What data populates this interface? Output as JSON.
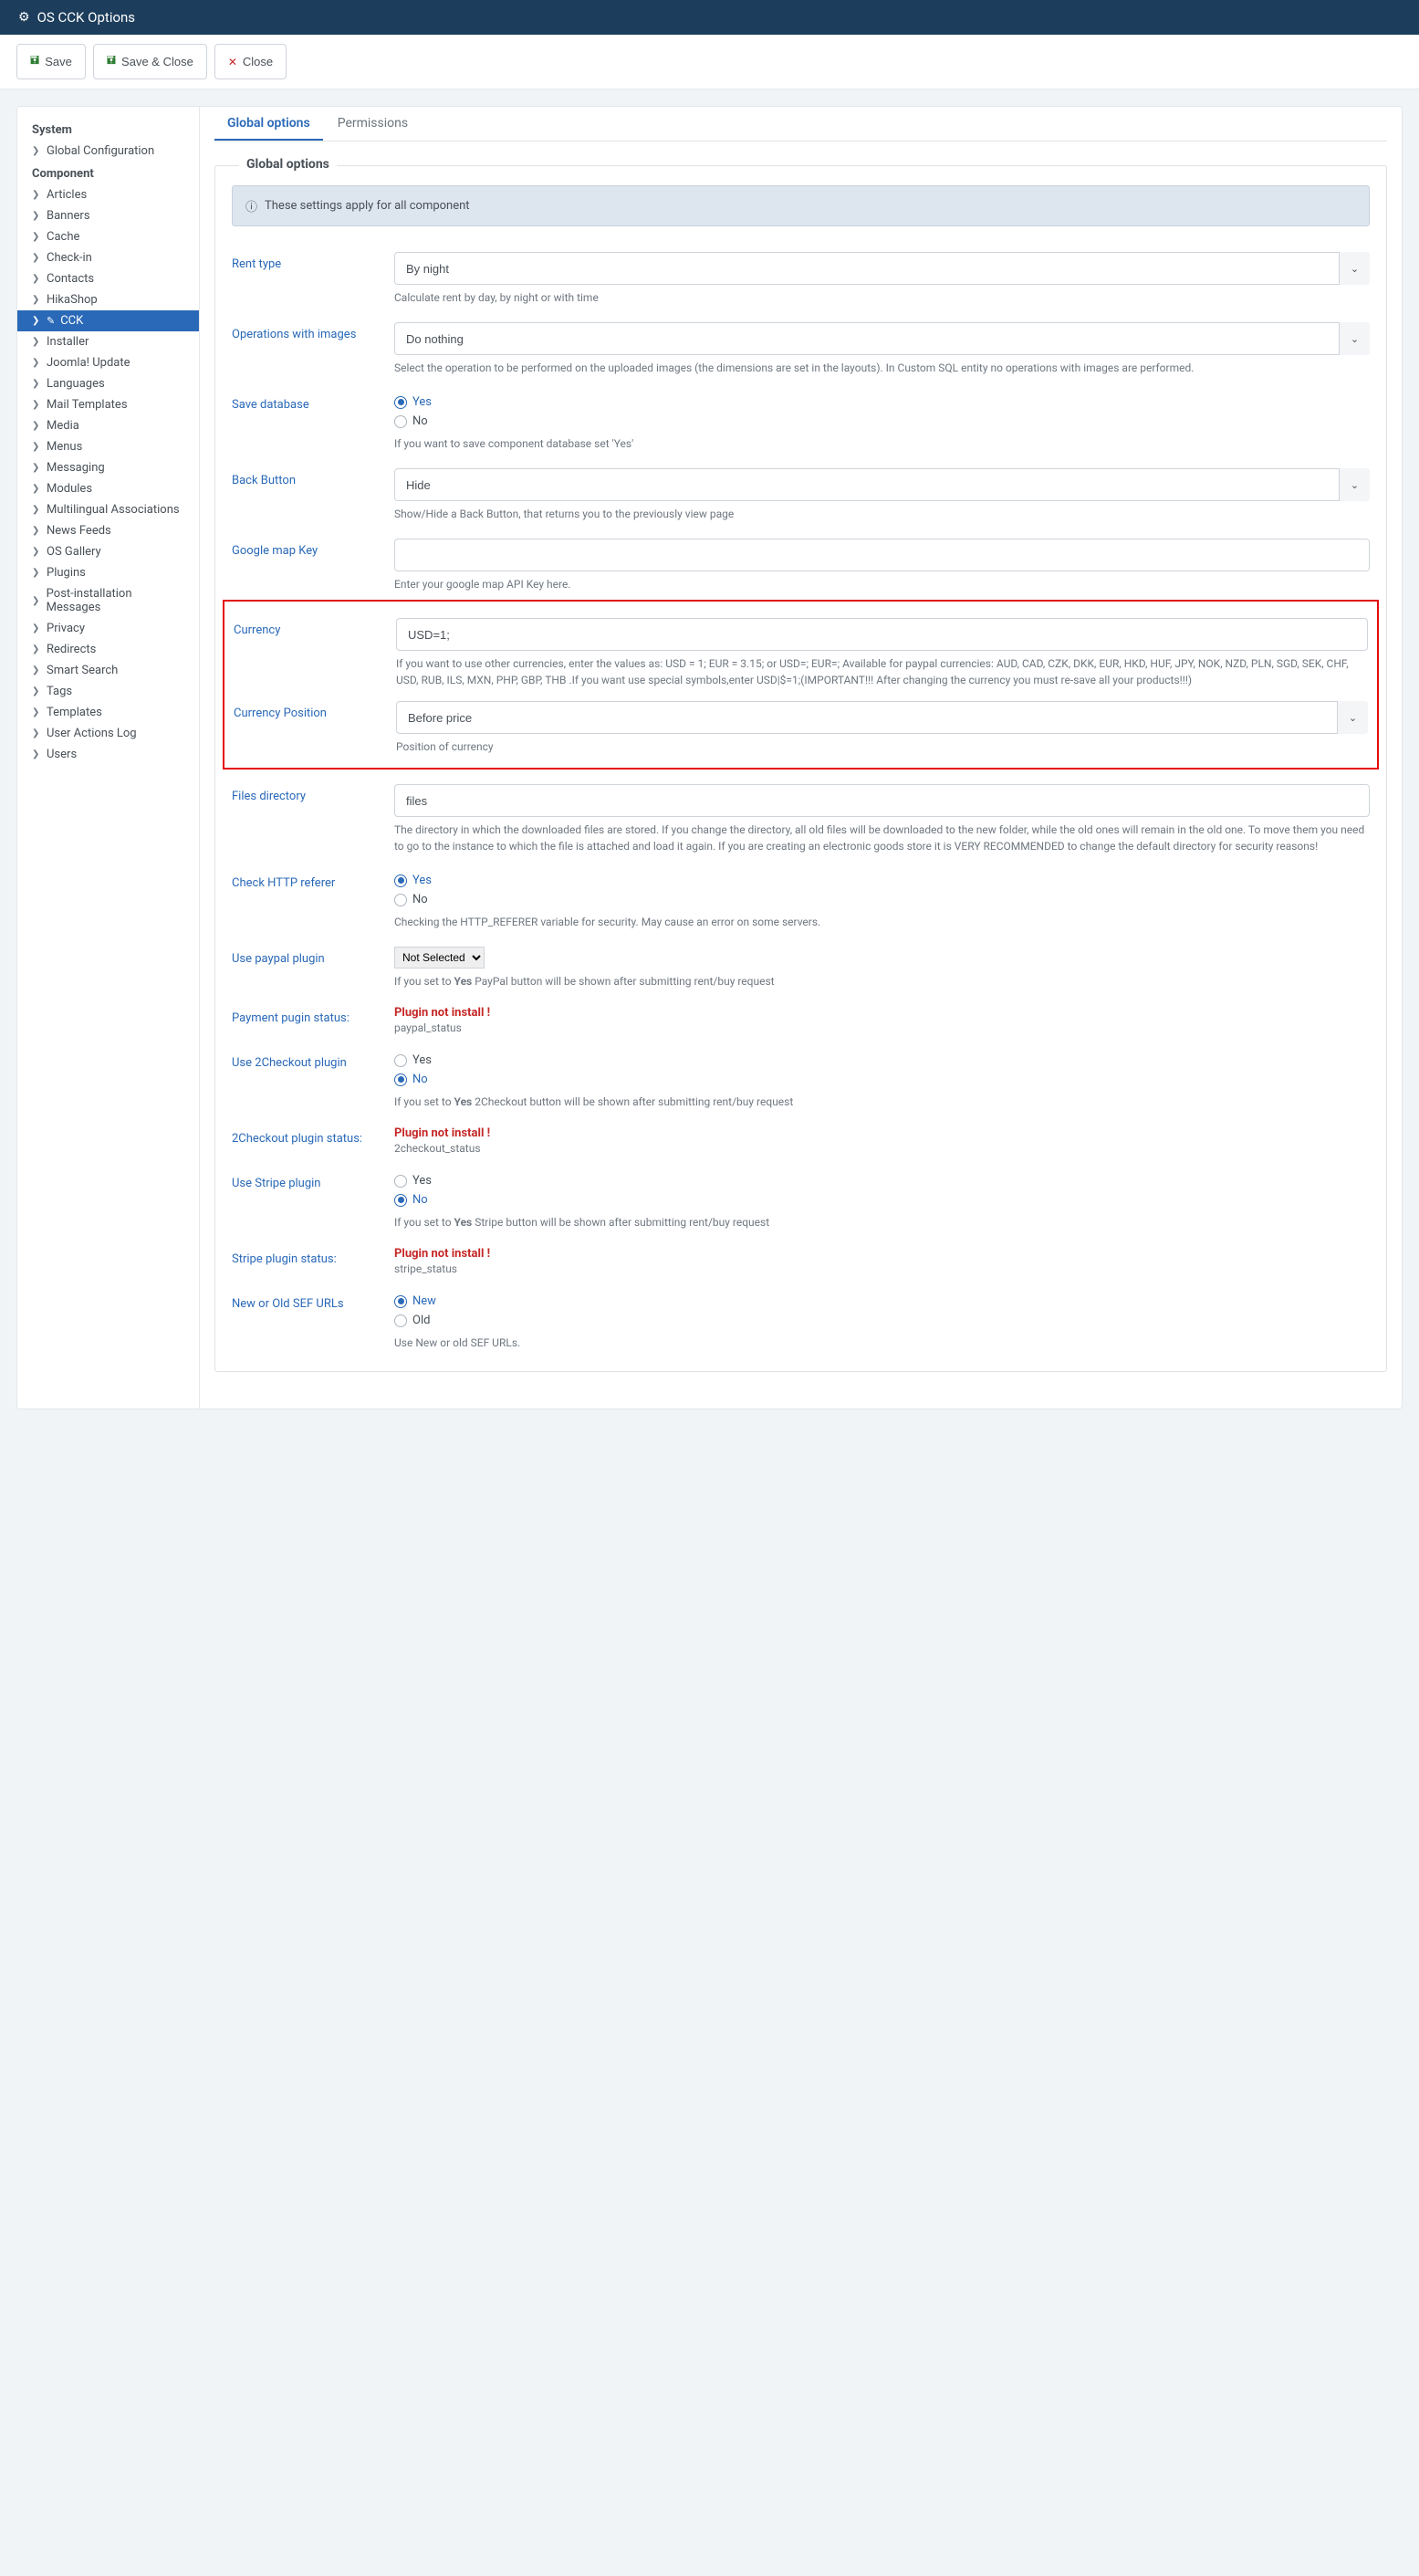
{
  "header": {
    "title": "OS CCK Options"
  },
  "toolbar": {
    "save": "Save",
    "save_close": "Save & Close",
    "close": "Close"
  },
  "sidebar": {
    "system_heading": "System",
    "system_items": [
      "Global Configuration"
    ],
    "component_heading": "Component",
    "component_items": [
      "Articles",
      "Banners",
      "Cache",
      "Check-in",
      "Contacts",
      "HikaShop",
      "CCK",
      "Installer",
      "Joomla! Update",
      "Languages",
      "Mail Templates",
      "Media",
      "Menus",
      "Messaging",
      "Modules",
      "Multilingual Associations",
      "News Feeds",
      "OS Gallery",
      "Plugins",
      "Post-installation Messages",
      "Privacy",
      "Redirects",
      "Smart Search",
      "Tags",
      "Templates",
      "User Actions Log",
      "Users"
    ],
    "active_component": "CCK"
  },
  "tabs": {
    "global": "Global options",
    "permissions": "Permissions"
  },
  "legend": "Global options",
  "info": "These settings apply for all component",
  "fields": {
    "rent_type": {
      "label": "Rent type",
      "value": "By night",
      "help": "Calculate rent by day, by night or with time"
    },
    "op_images": {
      "label": "Operations with images",
      "value": "Do nothing",
      "help": "Select the operation to be performed on the uploaded images (the dimensions are set in the layouts). In Custom SQL entity no operations with images are performed."
    },
    "save_db": {
      "label": "Save database",
      "yes": "Yes",
      "no": "No",
      "help": "If you want to save component database set 'Yes'",
      "selected": "yes"
    },
    "back_btn": {
      "label": "Back Button",
      "value": "Hide",
      "help": "Show/Hide a Back Button, that returns you to the previously view page"
    },
    "gmap": {
      "label": "Google map Key",
      "value": "",
      "help": "Enter your google map API Key here."
    },
    "currency": {
      "label": "Currency",
      "value": "USD=1;",
      "help": "If you want to use other currencies, enter the values as: USD = 1; EUR = 3.15; or USD=; EUR=; Available for paypal currencies: AUD, CAD, CZK, DKK, EUR, HKD, HUF, JPY, NOK, NZD, PLN, SGD, SEK, CHF, USD, RUB, ILS, MXN, PHP, GBP, THB .If you want use special symbols,enter USD|$=1;(IMPORTANT!!! After changing the currency you must re-save all your products!!!)"
    },
    "currency_pos": {
      "label": "Currency Position",
      "value": "Before price",
      "help": "Position of currency"
    },
    "files_dir": {
      "label": "Files directory",
      "value": "files",
      "help": "The directory in which the downloaded files are stored. If you change the directory, all old files will be downloaded to the new folder, while the old ones will remain in the old one. To move them you need to go to the instance to which the file is attached and load it again. If you are creating an electronic goods store it is VERY RECOMMENDED to change the default directory for security reasons!"
    },
    "http_ref": {
      "label": "Check HTTP referer",
      "yes": "Yes",
      "no": "No",
      "help": "Checking the HTTP_REFERER variable for security. May cause an error on some servers.",
      "selected": "yes"
    },
    "paypal": {
      "label": "Use paypal plugin",
      "value": "Not Selected",
      "help_pre": "If you set to ",
      "help_bold": "Yes",
      "help_post": " PayPal button will be shown after submitting rent/buy request"
    },
    "pay_status": {
      "label": "Payment pugin status:",
      "warn": "Plugin not install !",
      "sub": "paypal_status"
    },
    "checkout2": {
      "label": "Use 2Checkout plugin",
      "yes": "Yes",
      "no": "No",
      "selected": "no",
      "help_pre": "If you set to ",
      "help_bold": "Yes",
      "help_post": " 2Checkout button will be shown after submitting rent/buy request"
    },
    "checkout2_status": {
      "label": "2Checkout plugin status:",
      "warn": "Plugin not install !",
      "sub": "2checkout_status"
    },
    "stripe": {
      "label": "Use Stripe plugin",
      "yes": "Yes",
      "no": "No",
      "selected": "no",
      "help_pre": "If you set to ",
      "help_bold": "Yes",
      "help_post": " Stripe button will be shown after submitting rent/buy request"
    },
    "stripe_status": {
      "label": "Stripe plugin status:",
      "warn": "Plugin not install !",
      "sub": "stripe_status"
    },
    "sef": {
      "label": "New or Old SEF URLs",
      "new": "New",
      "old": "Old",
      "selected": "new",
      "help": "Use New or old SEF URLs."
    }
  }
}
